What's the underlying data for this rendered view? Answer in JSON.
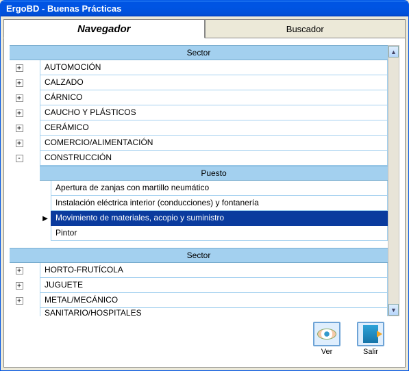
{
  "window": {
    "title": "ErgoBD -  Buenas Prácticas"
  },
  "tabs": {
    "navegador": "Navegador",
    "buscador": "Buscador"
  },
  "headers": {
    "sector": "Sector",
    "puesto": "Puesto"
  },
  "sectors_top": [
    {
      "label": "AUTOMOCIÓN",
      "expand": "+"
    },
    {
      "label": "CALZADO",
      "expand": "+"
    },
    {
      "label": "CÁRNICO",
      "expand": "+"
    },
    {
      "label": "CAUCHO Y PLÁSTICOS",
      "expand": "+"
    },
    {
      "label": "CERÁMICO",
      "expand": "+"
    },
    {
      "label": "COMERCIO/ALIMENTACIÓN",
      "expand": "+"
    },
    {
      "label": "CONSTRUCCIÓN",
      "expand": "-"
    }
  ],
  "puestos": [
    {
      "label": "Apertura de zanjas con martillo neumático",
      "selected": false
    },
    {
      "label": "Instalación eléctrica interior (conducciones) y fontanería",
      "selected": false
    },
    {
      "label": "Movimiento de materiales, acopio y suministro",
      "selected": true
    },
    {
      "label": "Pintor",
      "selected": false
    }
  ],
  "sectors_bottom": [
    {
      "label": "HORTO-FRUTÍCOLA",
      "expand": "+"
    },
    {
      "label": "JUGUETE",
      "expand": "+"
    },
    {
      "label": "METAL/MECÁNICO",
      "expand": "+"
    },
    {
      "label": "SANITARIO/HOSPITALES",
      "expand": ""
    }
  ],
  "buttons": {
    "ver": "Ver",
    "salir": "Salir"
  },
  "scroll": {
    "up": "▲",
    "down": "▼"
  }
}
